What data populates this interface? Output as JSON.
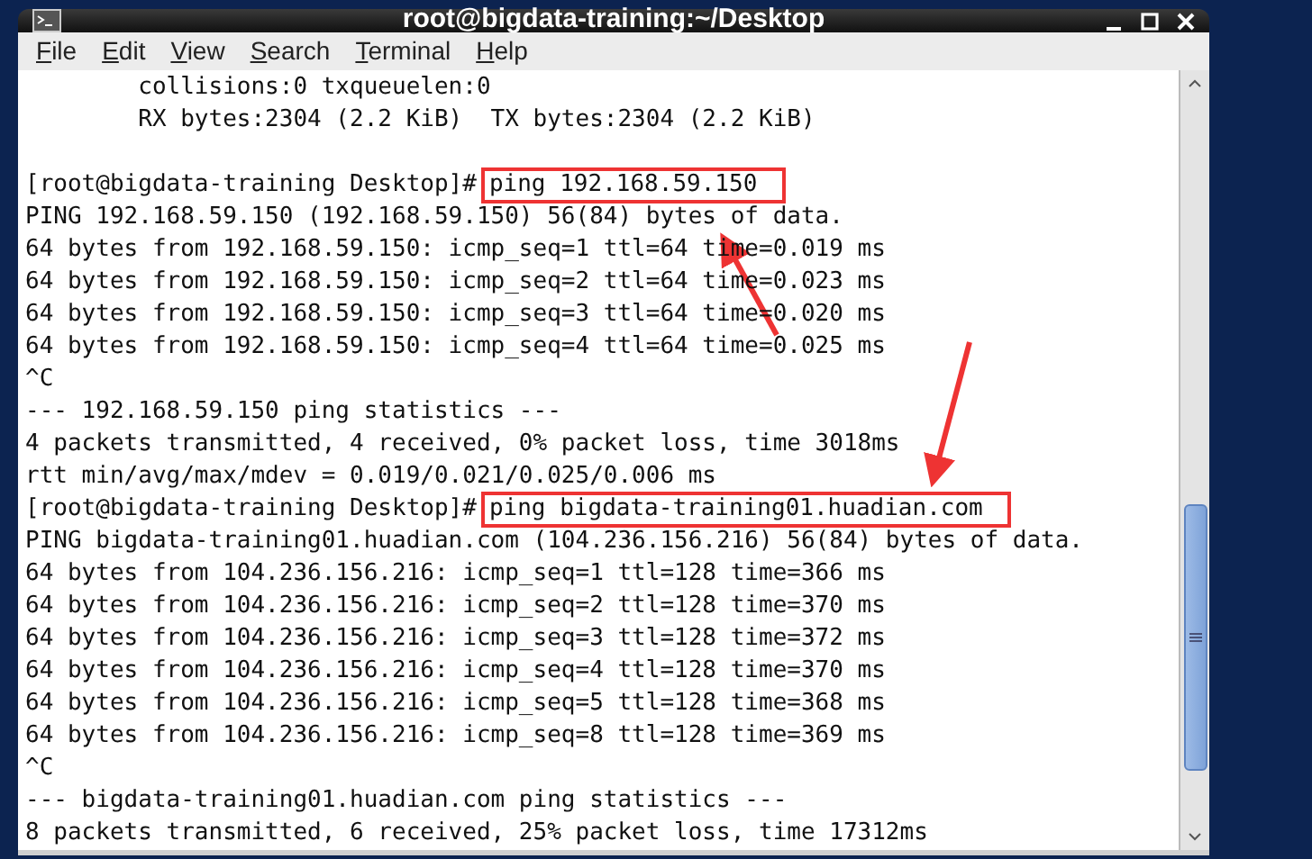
{
  "window": {
    "title": "root@bigdata-training:~/Desktop"
  },
  "menu": [
    "File",
    "Edit",
    "View",
    "Search",
    "Terminal",
    "Help"
  ],
  "terminal": {
    "lines": [
      {
        "kind": "text",
        "text": "        collisions:0 txqueuelen:0"
      },
      {
        "kind": "text",
        "text": "        RX bytes:2304 (2.2 KiB)  TX bytes:2304 (2.2 KiB)"
      },
      {
        "kind": "blank"
      },
      {
        "kind": "command",
        "prompt": "[root@bigdata-training Desktop]#",
        "command": "ping 192.168.59.150",
        "highlighted": true
      },
      {
        "kind": "text",
        "text": "PING 192.168.59.150 (192.168.59.150) 56(84) bytes of data."
      },
      {
        "kind": "text",
        "text": "64 bytes from 192.168.59.150: icmp_seq=1 ttl=64 time=0.019 ms"
      },
      {
        "kind": "text",
        "text": "64 bytes from 192.168.59.150: icmp_seq=2 ttl=64 time=0.023 ms"
      },
      {
        "kind": "text",
        "text": "64 bytes from 192.168.59.150: icmp_seq=3 ttl=64 time=0.020 ms"
      },
      {
        "kind": "text",
        "text": "64 bytes from 192.168.59.150: icmp_seq=4 ttl=64 time=0.025 ms"
      },
      {
        "kind": "text",
        "text": "^C"
      },
      {
        "kind": "text",
        "text": "--- 192.168.59.150 ping statistics ---"
      },
      {
        "kind": "text",
        "text": "4 packets transmitted, 4 received, 0% packet loss, time 3018ms"
      },
      {
        "kind": "text",
        "text": "rtt min/avg/max/mdev = 0.019/0.021/0.025/0.006 ms"
      },
      {
        "kind": "command",
        "prompt": "[root@bigdata-training Desktop]#",
        "command": "ping bigdata-training01.huadian.com",
        "highlighted": true
      },
      {
        "kind": "text",
        "text": "PING bigdata-training01.huadian.com (104.236.156.216) 56(84) bytes of data."
      },
      {
        "kind": "text",
        "text": "64 bytes from 104.236.156.216: icmp_seq=1 ttl=128 time=366 ms"
      },
      {
        "kind": "text",
        "text": "64 bytes from 104.236.156.216: icmp_seq=2 ttl=128 time=370 ms"
      },
      {
        "kind": "text",
        "text": "64 bytes from 104.236.156.216: icmp_seq=3 ttl=128 time=372 ms"
      },
      {
        "kind": "text",
        "text": "64 bytes from 104.236.156.216: icmp_seq=4 ttl=128 time=370 ms"
      },
      {
        "kind": "text",
        "text": "64 bytes from 104.236.156.216: icmp_seq=5 ttl=128 time=368 ms"
      },
      {
        "kind": "text",
        "text": "64 bytes from 104.236.156.216: icmp_seq=8 ttl=128 time=369 ms"
      },
      {
        "kind": "text",
        "text": "^C"
      },
      {
        "kind": "text",
        "text": "--- bigdata-training01.huadian.com ping statistics ---"
      },
      {
        "kind": "text",
        "text": "8 packets transmitted, 6 received, 25% packet loss, time 17312ms"
      }
    ]
  }
}
